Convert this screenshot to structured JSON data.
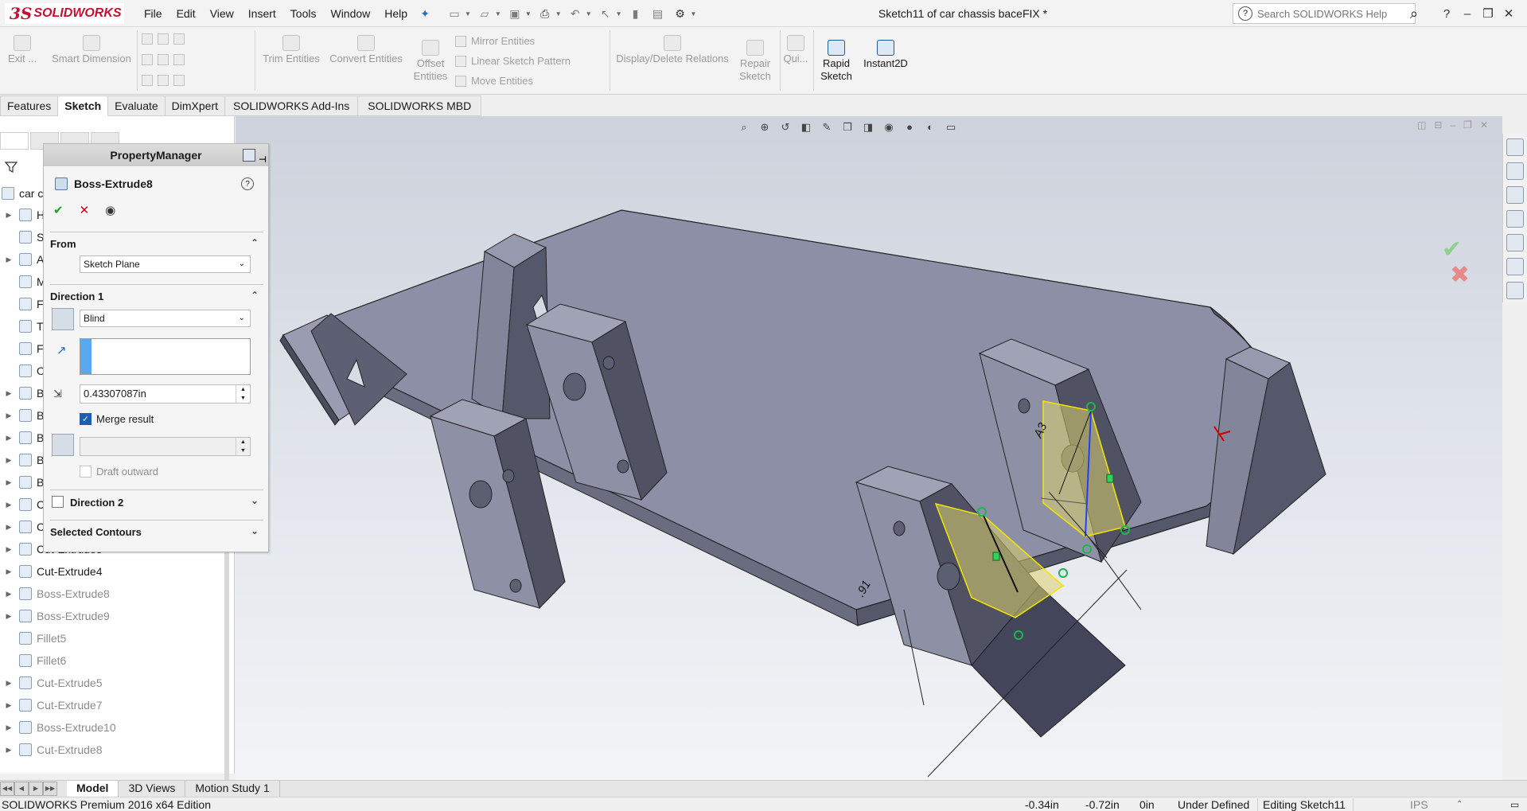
{
  "app": {
    "logo_ds": "3S",
    "logo_name": "SOLIDWORKS",
    "document_title": "Sketch11 of car chassis baceFIX *"
  },
  "menu": [
    "File",
    "Edit",
    "View",
    "Insert",
    "Tools",
    "Window",
    "Help"
  ],
  "search": {
    "placeholder": "Search SOLIDWORKS Help"
  },
  "commands": {
    "exit": "Exit ...",
    "smart_dimension": "Smart Dimension",
    "trim_entities": "Trim Entities",
    "convert_entities": "Convert Entities",
    "offset_entities_1": "Offset",
    "offset_entities_2": "Entities",
    "mirror_entities": "Mirror Entities",
    "linear_sketch_pattern": "Linear Sketch Pattern",
    "move_entities": "Move Entities",
    "display_delete_relations": "Display/Delete Relations",
    "repair_sketch_1": "Repair",
    "repair_sketch_2": "Sketch",
    "quick_snaps": "Qui...",
    "rapid_sketch_1": "Rapid",
    "rapid_sketch_2": "Sketch",
    "instant2d": "Instant2D"
  },
  "tabs": [
    "Features",
    "Sketch",
    "Evaluate",
    "DimXpert",
    "SOLIDWORKS Add-Ins",
    "SOLIDWORKS MBD"
  ],
  "active_tab": "Sketch",
  "tree": {
    "root_label": "car c",
    "partial_items": [
      "H",
      "S",
      "A",
      "M",
      "F",
      "T",
      "F",
      "O",
      "B",
      "B",
      "B",
      "B",
      "B",
      "C",
      "C",
      "Cut-Extrude3"
    ],
    "items": [
      {
        "label": "Cut-Extrude4",
        "suppressed": false
      },
      {
        "label": "Boss-Extrude8",
        "suppressed": true
      },
      {
        "label": "Boss-Extrude9",
        "suppressed": true
      },
      {
        "label": "Fillet5",
        "suppressed": true
      },
      {
        "label": "Fillet6",
        "suppressed": true
      },
      {
        "label": "Cut-Extrude5",
        "suppressed": true
      },
      {
        "label": "Cut-Extrude7",
        "suppressed": true
      },
      {
        "label": "Boss-Extrude10",
        "suppressed": true
      },
      {
        "label": "Cut-Extrude8",
        "suppressed": true
      }
    ]
  },
  "property_manager": {
    "header": "PropertyManager",
    "feature_name": "Boss-Extrude8",
    "from_label": "From",
    "from_value": "Sketch Plane",
    "direction1_label": "Direction 1",
    "end_condition": "Blind",
    "depth_value": "0.43307087in",
    "merge_result_label": "Merge result",
    "merge_result_checked": true,
    "draft_outward_label": "Draft outward",
    "direction2_label": "Direction 2",
    "selected_contours_label": "Selected Contours"
  },
  "viewport": {
    "dimension_1": "A3",
    "dimension_2": ".91"
  },
  "bottom_tabs": [
    "Model",
    "3D Views",
    "Motion Study 1"
  ],
  "active_bottom_tab": "Model",
  "status": {
    "edition": "SOLIDWORKS Premium 2016 x64 Edition",
    "x": "-0.34in",
    "y": "-0.72in",
    "z": "0in",
    "definition": "Under Defined",
    "editing": "Editing Sketch11",
    "units": "IPS"
  },
  "colors": {
    "brand_red": "#c8102e",
    "ok_green": "#1f9e2c",
    "cancel_red": "#d0021b",
    "sketch_yellow": "#f2e600",
    "selection_blue": "#5aa8f0"
  }
}
